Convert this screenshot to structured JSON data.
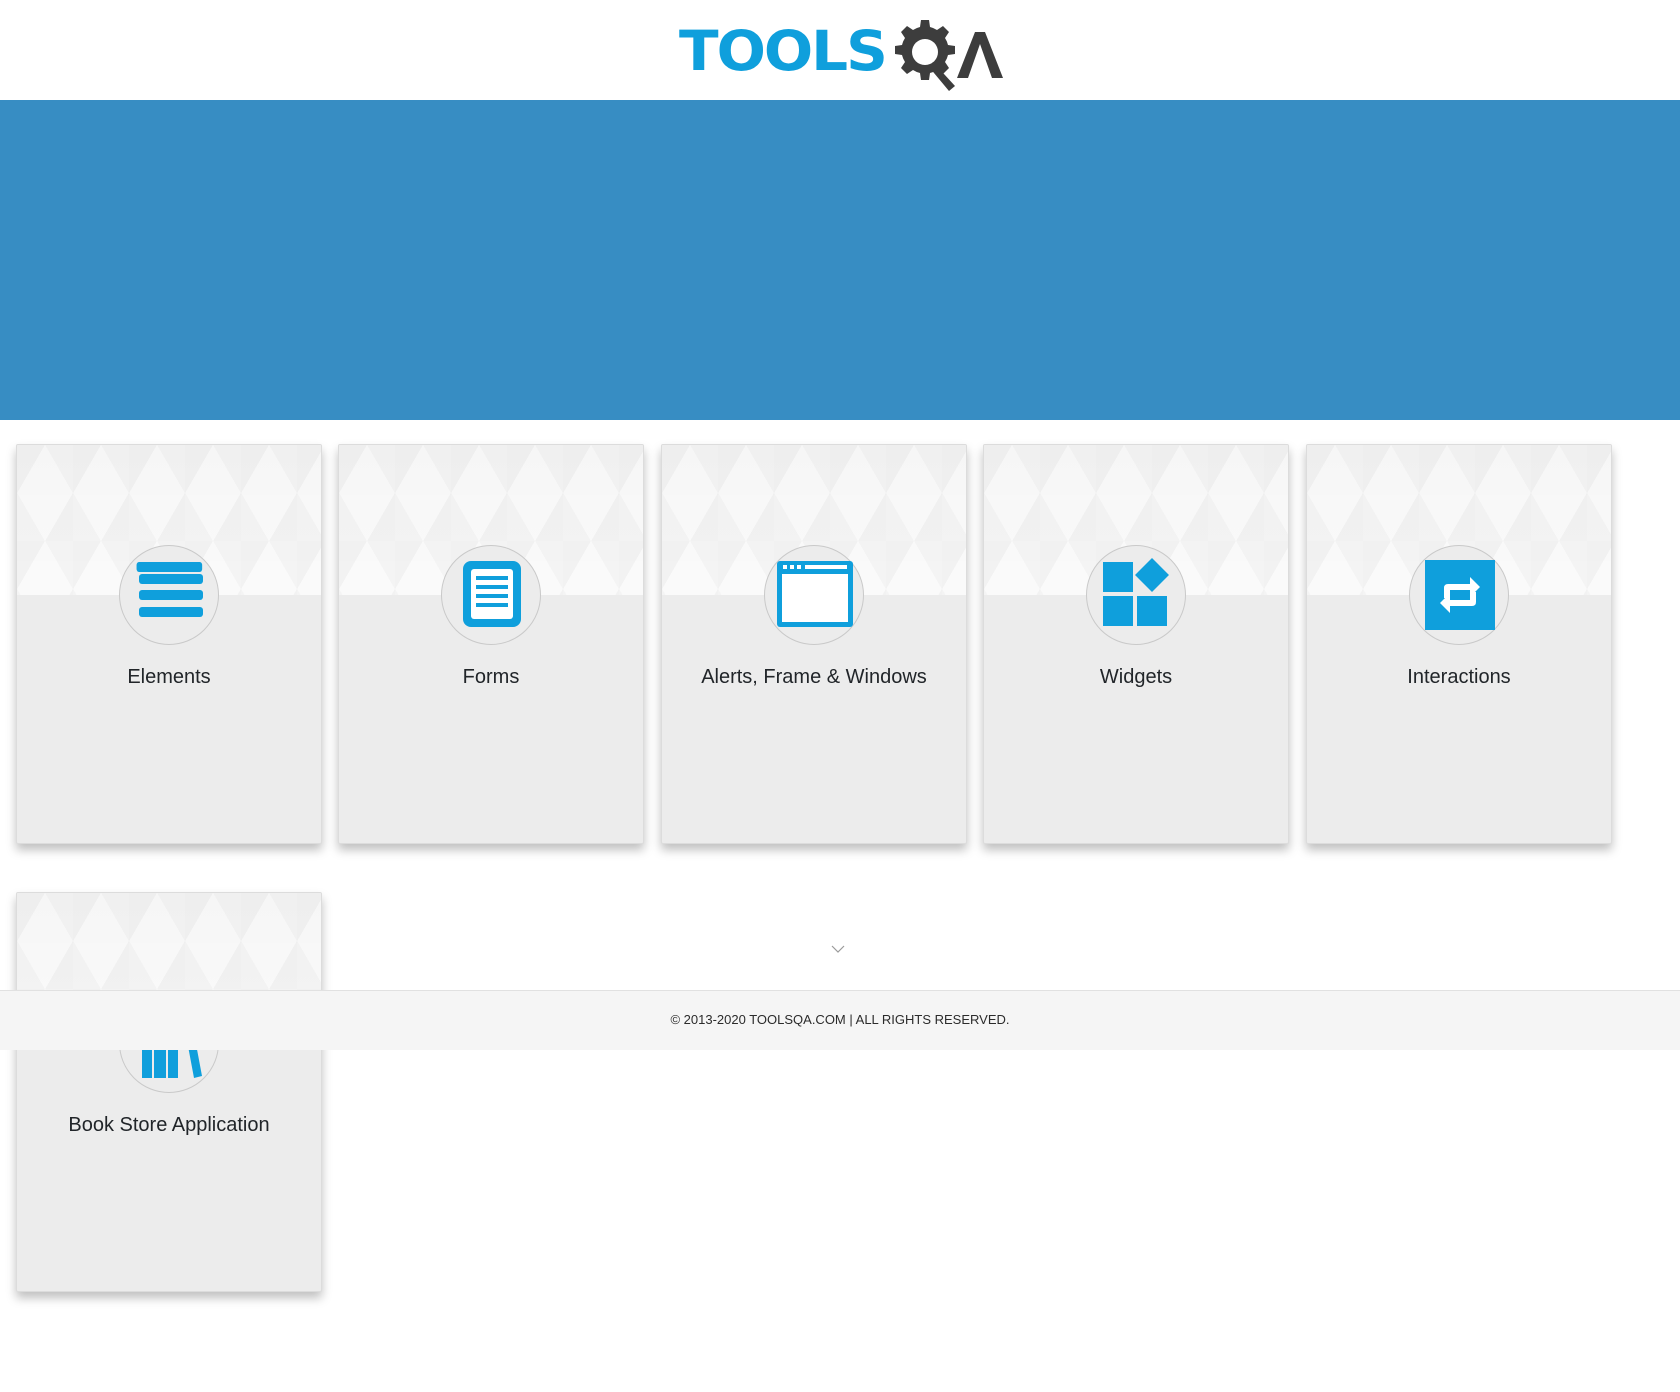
{
  "header": {
    "logo_text_left": "TOOLS",
    "logo_text_right": "QA",
    "logo_alt": "ToolsQA"
  },
  "colors": {
    "brand_blue": "#0f9fdc",
    "banner_blue": "#378dc3",
    "logo_dark": "#3d3d3d",
    "card_bg": "#ececec"
  },
  "cards": [
    {
      "title": "Elements",
      "icon": "list-icon"
    },
    {
      "title": "Forms",
      "icon": "form-document-icon"
    },
    {
      "title": "Alerts, Frame & Windows",
      "icon": "browser-window-icon"
    },
    {
      "title": "Widgets",
      "icon": "widgets-icon"
    },
    {
      "title": "Interactions",
      "icon": "interactions-arrows-icon"
    },
    {
      "title": "Book Store Application",
      "icon": "bookshelf-icon"
    }
  ],
  "footer": {
    "copyright": "© 2013-2020 TOOLSQA.COM | ALL RIGHTS RESERVED."
  }
}
